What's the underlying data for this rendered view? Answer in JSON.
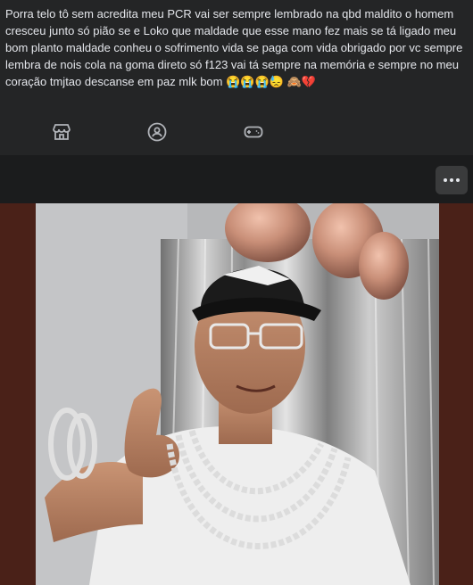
{
  "post": {
    "text": "Porra telo tô sem acredita meu PCR vai ser sempre lembrado na qbd maldito o homem cresceu junto só pião se e Loko que maldade que esse mano fez mais se tá ligado meu bom planto maldade conheu o sofrimento vida se paga com vida obrigado por vc sempre lembra de nois cola na goma direto só f123 vai tá sempre na memória e sempre no meu coração tmjtao descanse em paz mlk bom 😭😭😭😓 🙈💔"
  },
  "nav": {
    "items": [
      {
        "icon": "marketplace-icon"
      },
      {
        "icon": "groups-icon"
      },
      {
        "icon": "gaming-icon"
      }
    ]
  },
  "photo_header": {
    "more_icon": "more-options-icon"
  },
  "colors": {
    "background": "#242526",
    "photo_frame": "#4a2118",
    "text": "#e4e6eb"
  }
}
